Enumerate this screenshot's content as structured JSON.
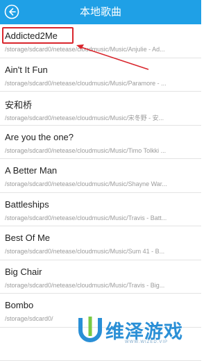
{
  "header": {
    "title": "本地歌曲",
    "back_icon": "back-arrow-icon"
  },
  "songs": [
    {
      "title": "Addicted2Me",
      "path": "/storage/sdcard0/netease/cloudmusic/Music/Anjulie - Ad..."
    },
    {
      "title": "Ain't It Fun",
      "path": "/storage/sdcard0/netease/cloudmusic/Music/Paramore - ..."
    },
    {
      "title": "安和桥",
      "path": "/storage/sdcard0/netease/cloudmusic/Music/宋冬野 - 安..."
    },
    {
      "title": "Are you the one?",
      "path": "/storage/sdcard0/netease/cloudmusic/Music/Timo Tolkki ..."
    },
    {
      "title": "A Better Man",
      "path": "/storage/sdcard0/netease/cloudmusic/Music/Shayne War..."
    },
    {
      "title": "Battleships",
      "path": "/storage/sdcard0/netease/cloudmusic/Music/Travis - Batt..."
    },
    {
      "title": "Best Of Me",
      "path": "/storage/sdcard0/netease/cloudmusic/Music/Sum 41 - B..."
    },
    {
      "title": "Big Chair",
      "path": "/storage/sdcard0/netease/cloudmusic/Music/Travis - Big..."
    },
    {
      "title": "Bombo",
      "path": "/storage/sdcard0/"
    },
    {
      "title": "",
      "path": ""
    }
  ],
  "watermark": {
    "text": "维泽游戏",
    "sub": "WWW.WIZED.VIP"
  },
  "colors": {
    "header": "#1fa0e6",
    "highlight": "#d9252c"
  }
}
